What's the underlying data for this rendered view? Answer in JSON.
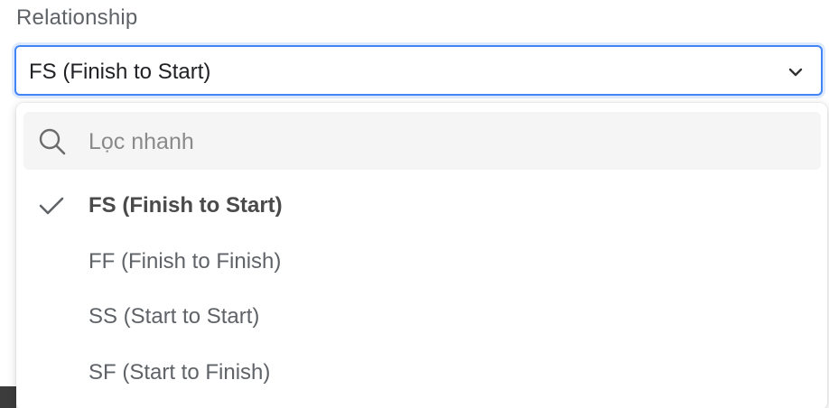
{
  "field": {
    "label": "Relationship",
    "selected_value": "FS (Finish to Start)"
  },
  "dropdown": {
    "search": {
      "placeholder": "Lọc nhanh",
      "icon": "search-icon"
    },
    "options": [
      {
        "label": "FS (Finish to Start)",
        "selected": true
      },
      {
        "label": "FF (Finish to Finish)",
        "selected": false
      },
      {
        "label": "SS (Start to Start)",
        "selected": false
      },
      {
        "label": "SF (Start to Finish)",
        "selected": false
      }
    ]
  },
  "colors": {
    "focus_border": "#4285f4",
    "search_bg": "#f5f5f5",
    "label_text": "#5f6368"
  }
}
